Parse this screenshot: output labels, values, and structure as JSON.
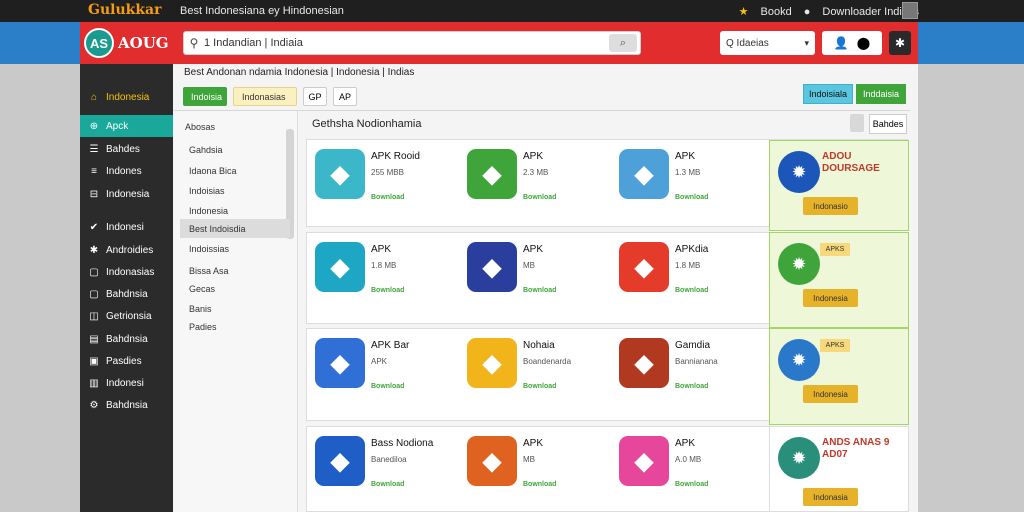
{
  "topbar": {
    "brand": "Gulukkar",
    "tagline": "Best Indonesiana ey Hindonesian",
    "star_label": "Bookd",
    "account_label": "Downloader Indicas"
  },
  "header": {
    "logo_mark": "AS",
    "logo_text": "AOUG",
    "search_value": "1 Indandian | Indiaia",
    "camera_label": "⌕",
    "select_value": "Q Idaeias",
    "colors": {
      "red": "#e12d2d",
      "blue": "#2b7fc9",
      "teal": "#1aa89a",
      "green": "#3fa53a"
    }
  },
  "sidebar": {
    "items": [
      {
        "icon": "home-icon",
        "glyph": "⌂",
        "label": "Indonesia"
      },
      {
        "icon": "apps-icon",
        "glyph": "⊕",
        "label": "Apck"
      },
      {
        "icon": "list-icon",
        "glyph": "☰",
        "label": "Bahdes"
      },
      {
        "icon": "grid-icon",
        "glyph": "≡",
        "label": "Indones"
      },
      {
        "icon": "book-icon",
        "glyph": "⊟",
        "label": "Indonesia"
      },
      {
        "icon": "check-icon",
        "glyph": "✔",
        "label": "Indonesi"
      },
      {
        "icon": "star-icon",
        "glyph": "✱",
        "label": "Androidies"
      },
      {
        "icon": "square-icon",
        "glyph": "▢",
        "label": "Indonasias"
      },
      {
        "icon": "square-icon",
        "glyph": "▢",
        "label": "Bahdnsia"
      },
      {
        "icon": "folder-icon",
        "glyph": "◫",
        "label": "Getrionsia"
      },
      {
        "icon": "doc-icon",
        "glyph": "▤",
        "label": "Bahdnsia"
      },
      {
        "icon": "file-icon",
        "glyph": "▣",
        "label": "Pasdies"
      },
      {
        "icon": "box-icon",
        "glyph": "▥",
        "label": "Indonesi"
      },
      {
        "icon": "gear-icon",
        "glyph": "⚙",
        "label": "Bahdnsia"
      }
    ]
  },
  "main": {
    "breadcrumb": "Best Andonan ndamia Indonesia | Indonesia | Indias",
    "chips": [
      "Indoisia",
      "Indonasias",
      "GP",
      "AP"
    ],
    "top_buttons": [
      "Indoisiala",
      "Inddaisia"
    ],
    "list_heading": "Gethsha Nodionhamia",
    "sort_label": "Bahdes",
    "categories_heading": "Abosas",
    "categories": [
      "Gahdsia",
      "Idaona Bica",
      "Indoisias",
      "Indonesia",
      "Best Indoisdia",
      "Indoissias",
      "Bissa Asa",
      "Gecas",
      "Banis",
      "Padies"
    ]
  },
  "apps": [
    [
      {
        "name": "APK Rooid",
        "meta": "255 MBB",
        "link": "Bownload",
        "icon": "bird-icon",
        "color": "#3bb7c9"
      },
      {
        "name": "APK",
        "meta": "2.3 MB",
        "link": "Bownload",
        "icon": "compass-icon",
        "color": "#3fa53a"
      },
      {
        "name": "APK",
        "meta": "1.3 MB",
        "link": "Bownload",
        "icon": "character-icon",
        "color": "#4ea0d9"
      }
    ],
    [
      {
        "name": "APK",
        "meta": "1.8 MB",
        "link": "Bownload",
        "icon": "pencil-icon",
        "color": "#1da7c4"
      },
      {
        "name": "APK",
        "meta": "MB",
        "link": "Bownload",
        "icon": "badge-icon",
        "color": "#2a3e9e"
      },
      {
        "name": "APKdia",
        "meta": "1.8 MB",
        "link": "Bownload",
        "icon": "bolt-icon",
        "color": "#e43b2b"
      }
    ],
    [
      {
        "name": "APK Bar",
        "meta": "APK",
        "link": "Bownload",
        "icon": "letter-a-icon",
        "color": "#2f6fd6"
      },
      {
        "name": "Nohaia",
        "meta": "Boandenarda",
        "link": "Bownload",
        "icon": "star-icon",
        "color": "#f1b41b"
      },
      {
        "name": "Gamdia",
        "meta": "Bannianana",
        "link": "Bownload",
        "icon": "game-icon",
        "color": "#b0391f"
      }
    ],
    [
      {
        "name": "Bass Nodiona",
        "meta": "Banediloa",
        "link": "Bownload",
        "icon": "letter-a-icon",
        "color": "#1e5ec6"
      },
      {
        "name": "APK",
        "meta": "MB",
        "link": "Bownload",
        "icon": "face-icon",
        "color": "#e06221"
      },
      {
        "name": "APK",
        "meta": "A.0 MB",
        "link": "Bownload",
        "icon": "flower-icon",
        "color": "#e6479b"
      }
    ]
  ],
  "promos": [
    {
      "title": "ADOU DOURSAGE",
      "button": "Indonasio",
      "icon": "gear-badge-icon",
      "color": "#1c56b8"
    },
    {
      "title": "APKS",
      "button": "Indonesia",
      "icon": "android-icon",
      "color": "#3fa53a"
    },
    {
      "title": "APKS",
      "button": "Indonesia",
      "icon": "shell-icon",
      "color": "#2a78c9"
    },
    {
      "title": "ANDS ANAS 9 AD07",
      "button": "Indonasia",
      "icon": "coin-icon",
      "color": "#2a8f7a"
    }
  ]
}
